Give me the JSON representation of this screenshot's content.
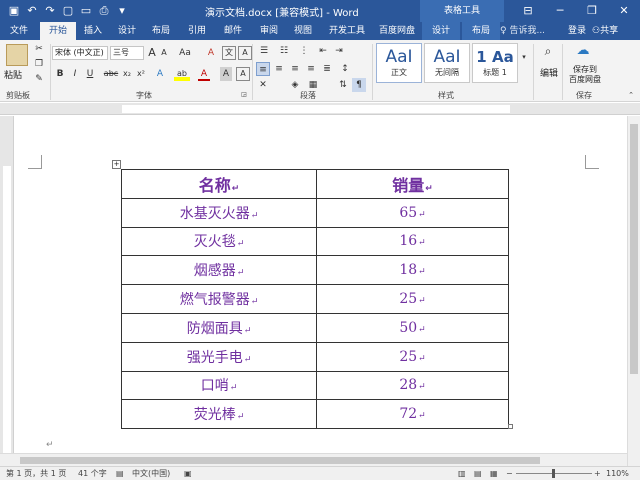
{
  "window": {
    "title": "演示文档.docx [兼容模式] - Word",
    "context_group": "表格工具",
    "qa_icons": [
      "save-icon",
      "undo-icon",
      "redo-icon",
      "new-doc-icon",
      "open-icon",
      "print-preview-icon",
      "customize-icon"
    ],
    "minimize": "─",
    "restore": "❐",
    "close": "✕",
    "ribbon_display": "⊟"
  },
  "tabs": [
    "文件",
    "开始",
    "插入",
    "设计",
    "布局",
    "引用",
    "邮件",
    "审阅",
    "视图",
    "开发工具",
    "百度网盘",
    "设计",
    "布局"
  ],
  "active_tab": "开始",
  "tell_me": "告诉我...",
  "login": "登录",
  "share": "共享",
  "ribbon": {
    "clipboard": {
      "paste": "粘贴",
      "label": "剪贴板"
    },
    "font": {
      "name": "宋体 (中文正)",
      "size": "三号",
      "grow": "A",
      "shrink": "A",
      "case": "Aa",
      "clear": "A",
      "bold": "B",
      "italic": "I",
      "underline": "U",
      "strike": "abc",
      "sub": "x₂",
      "sup": "x²",
      "effects": "A",
      "highlight": "ab",
      "color": "A",
      "border": "A",
      "label": "字体"
    },
    "paragraph": {
      "label": "段落",
      "marks": "¶"
    },
    "styles": {
      "items": [
        {
          "sample": "AaI",
          "name": "正文"
        },
        {
          "sample": "AaI",
          "name": "无间隔"
        },
        {
          "sample": "1 Aa",
          "name": "标题 1"
        }
      ],
      "label": "样式"
    },
    "editing": {
      "label": "编辑"
    },
    "save": {
      "line1": "保存到",
      "line2": "百度网盘",
      "label": "保存"
    }
  },
  "table": {
    "headers": [
      "名称",
      "销量"
    ],
    "rows": [
      [
        "水基灭火器",
        "65"
      ],
      [
        "灭火毯",
        "16"
      ],
      [
        "烟感器",
        "18"
      ],
      [
        "燃气报警器",
        "25"
      ],
      [
        "防烟面具",
        "50"
      ],
      [
        "强光手电",
        "25"
      ],
      [
        "口哨",
        "28"
      ],
      [
        "荧光棒",
        "72"
      ]
    ],
    "mark": "↵"
  },
  "status": {
    "page": "第 1 页，共 1 页",
    "words": "41 个字",
    "lang": "中文(中国)",
    "zoom": "110%"
  },
  "colors": {
    "accent": "#2b579a",
    "table_text": "#7030a0"
  }
}
